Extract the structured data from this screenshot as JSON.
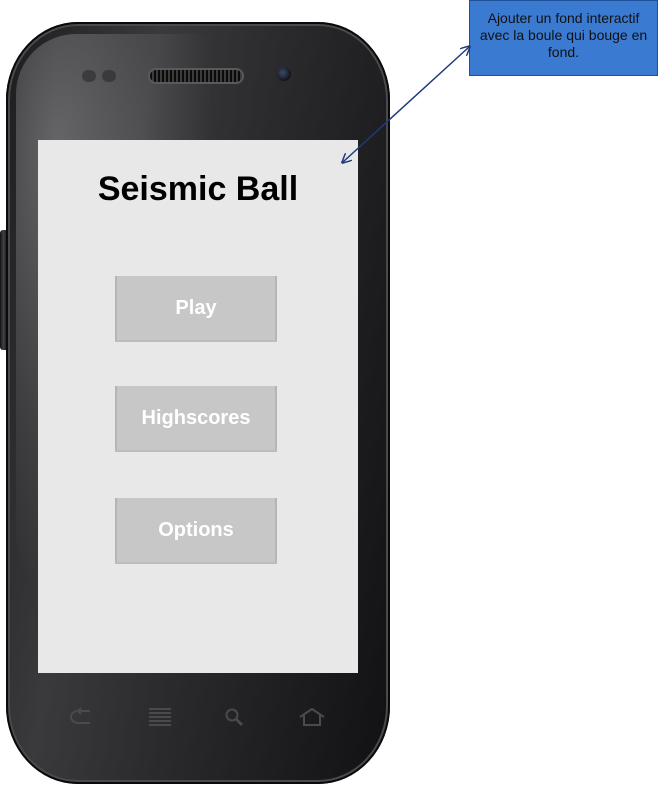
{
  "app": {
    "title": "Seismic Ball"
  },
  "menu": {
    "play_label": "Play",
    "highscores_label": "Highscores",
    "options_label": "Options"
  },
  "annotation": {
    "text": "Ajouter un fond interactif avec la boule qui bouge en fond."
  },
  "nav_icons": [
    "back-icon",
    "menu-icon",
    "search-icon",
    "home-icon"
  ],
  "colors": {
    "screen_bg": "#e8e8e8",
    "button_bg": "#c7c7c7",
    "button_text": "#ffffff",
    "title_text": "#000000",
    "callout_bg": "#3b7ad1",
    "arrow": "#1f3a7a"
  }
}
